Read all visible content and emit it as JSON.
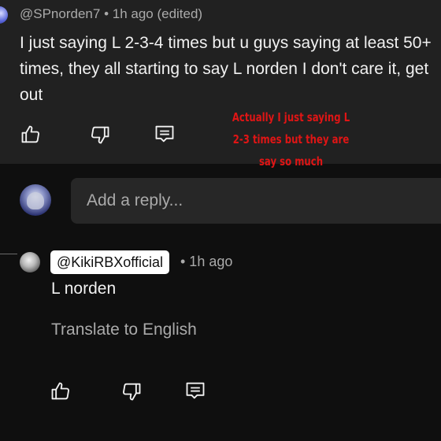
{
  "comment": {
    "author": "@SPnorden7",
    "meta": "• 1h ago (edited)",
    "text": "I just saying L 2-3-4 times but u guys saying at least 50+ times, they all starting to say L norden I don't care it, get out"
  },
  "annotation": {
    "text": "Actually I just saying L\n2-3 times but they are\nsay so much",
    "color": "#e01515"
  },
  "reply_input": {
    "placeholder": "Add a reply..."
  },
  "reply": {
    "author": "@KikiRBXofficial",
    "meta": "• 1h ago",
    "text": "L norden",
    "translate_label": "Translate to English"
  },
  "icons": {
    "like": "thumbs-up-icon",
    "dislike": "thumbs-down-icon",
    "reply": "comment-icon"
  },
  "colors": {
    "background": "#0f0f0f",
    "top_panel": "#212121",
    "input_background": "#272727",
    "secondary_text": "#aaaaaa"
  }
}
